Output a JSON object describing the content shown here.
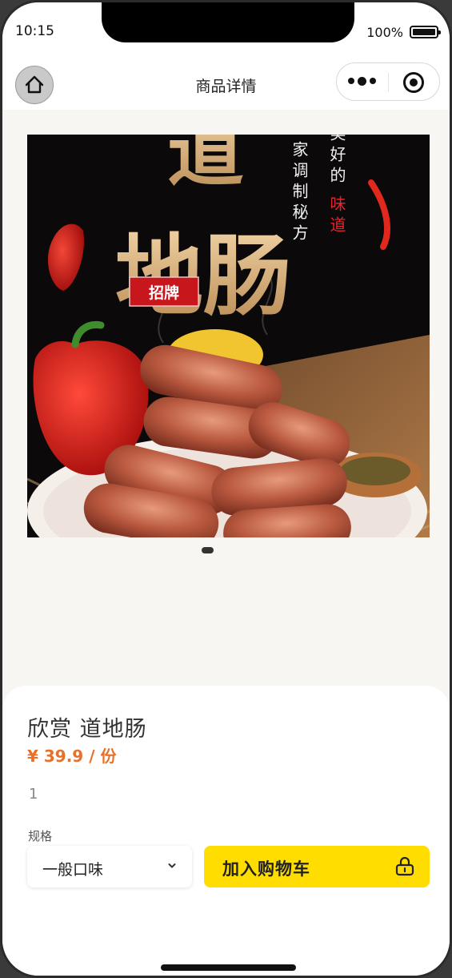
{
  "status_bar": {
    "time": "10:15",
    "battery": "100%"
  },
  "nav": {
    "title": "商品详情",
    "home_icon": "home-icon",
    "more_icon": "more-dots-icon",
    "target_icon": "close-target-icon"
  },
  "product": {
    "image_text": {
      "big_top": "道",
      "big_main": "地肠",
      "stamp": "招牌",
      "col1": "家调制秘方",
      "col2a": "美好的",
      "col2b": "味道"
    },
    "name": "欣赏 道地肠",
    "price": "¥ 39.9 / 份",
    "quantity": "1",
    "spec_label": "规格",
    "spec_value": "一般口味",
    "add_to_cart": "加入购物车"
  },
  "colors": {
    "accent": "#ffdd00",
    "price": "#e8712a",
    "stamp": "#c8161d"
  }
}
